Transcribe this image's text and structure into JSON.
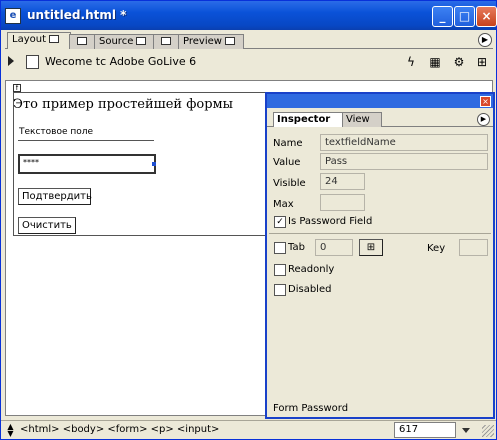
{
  "window": {
    "title": "untitled.html *",
    "controls": {
      "minimize": "_",
      "maximize": "□",
      "close": "×"
    }
  },
  "tabs": [
    {
      "label": "Layout",
      "active": true
    },
    {
      "label": "",
      "active": false
    },
    {
      "label": "Source",
      "active": false
    },
    {
      "label": "",
      "active": false
    },
    {
      "label": "Preview",
      "active": false
    }
  ],
  "toolbar": {
    "page_title": "Wecome tc Adobe GoLive 6",
    "icons": [
      "lightning-icon",
      "layout-icon",
      "gear-icon",
      "tree-icon"
    ]
  },
  "document": {
    "heading": "Это пример простейшей формы",
    "text_field_value": "Текстовое поле",
    "password_field_value": "****",
    "submit_button": "Подтвердить",
    "reset_button": "Очистить"
  },
  "inspector": {
    "title": "",
    "tabs": [
      "Inspector",
      "View"
    ],
    "fields": {
      "name_label": "Name",
      "name_value": "textfieldName",
      "value_label": "Value",
      "value_value": "Pass",
      "visible_label": "Visible",
      "visible_value": "24",
      "max_label": "Max",
      "max_value": "",
      "is_password_label": "Is Password Field",
      "is_password_checked": true,
      "tab_label": "Tab",
      "tab_value": "0",
      "key_label": "Key",
      "key_value": "",
      "readonly_label": "Readonly",
      "disabled_label": "Disabled"
    },
    "footer": "Form Password"
  },
  "statusbar": {
    "path": "<html> <body> <form> <p> <input>",
    "size": "617"
  },
  "colors": {
    "titlebar": "#0a52d8",
    "inspector_border": "#1941c9",
    "selection_handle": "#1f4fd1"
  }
}
